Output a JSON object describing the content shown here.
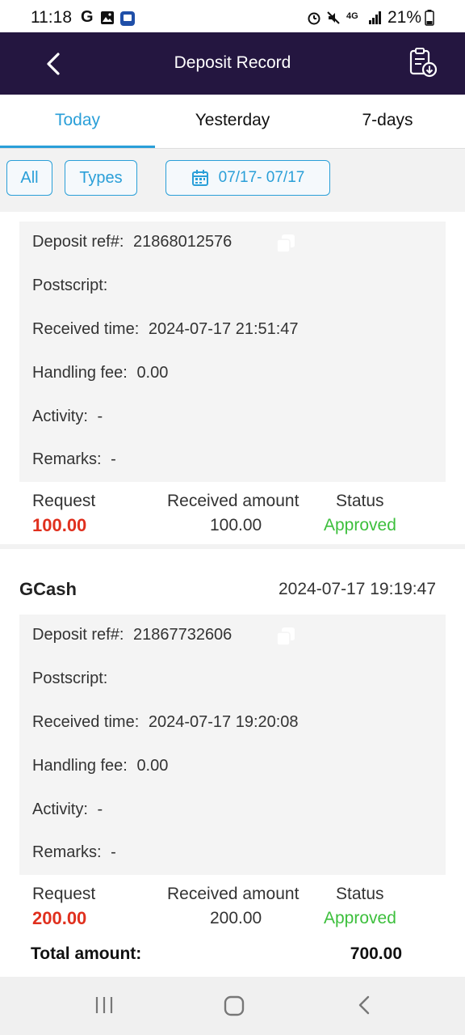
{
  "status_bar": {
    "time": "11:18",
    "g_label": "G",
    "signal_label": "4G",
    "battery_percent": "21%"
  },
  "header": {
    "title": "Deposit Record"
  },
  "tabs": [
    {
      "label": "Today",
      "active": true
    },
    {
      "label": "Yesterday",
      "active": false
    },
    {
      "label": "7-days",
      "active": false
    }
  ],
  "filters": {
    "all_label": "All",
    "types_label": "Types",
    "date_range": "07/17- 07/17"
  },
  "records": [
    {
      "deposit_ref_label": "Deposit ref#:",
      "deposit_ref": "21868012576",
      "postscript_label": "Postscript:",
      "received_time_label": "Received time:",
      "received_time": "2024-07-17 21:51:47",
      "handling_fee_label": "Handling fee:",
      "handling_fee": "0.00",
      "activity_label": "Activity:",
      "activity": "-",
      "remarks_label": "Remarks:",
      "remarks": "-",
      "request_label": "Request",
      "request": "100.00",
      "received_amount_label": "Received amount",
      "received_amount": "100.00",
      "status_label": "Status",
      "status": "Approved"
    },
    {
      "method": "GCash",
      "datetime": "2024-07-17 19:19:47",
      "deposit_ref_label": "Deposit ref#:",
      "deposit_ref": "21867732606",
      "postscript_label": "Postscript:",
      "received_time_label": "Received time:",
      "received_time": "2024-07-17 19:20:08",
      "handling_fee_label": "Handling fee:",
      "handling_fee": "0.00",
      "activity_label": "Activity:",
      "activity": "-",
      "remarks_label": "Remarks:",
      "remarks": "-",
      "request_label": "Request",
      "request": "200.00",
      "received_amount_label": "Received amount",
      "received_amount": "200.00",
      "status_label": "Status",
      "status": "Approved"
    }
  ],
  "total": {
    "label": "Total amount:",
    "value": "700.00"
  },
  "colors": {
    "header_bg": "#241640",
    "accent": "#2a9fd8",
    "request_red": "#e0301e",
    "approved_green": "#3cbf3c"
  },
  "icons": {
    "back": "chevron-left-icon",
    "download_doc": "clipboard-download-icon",
    "calendar": "calendar-icon",
    "copy": "copy-icon",
    "nav_recents": "recents-icon",
    "nav_home": "home-icon",
    "nav_back": "back-icon"
  }
}
